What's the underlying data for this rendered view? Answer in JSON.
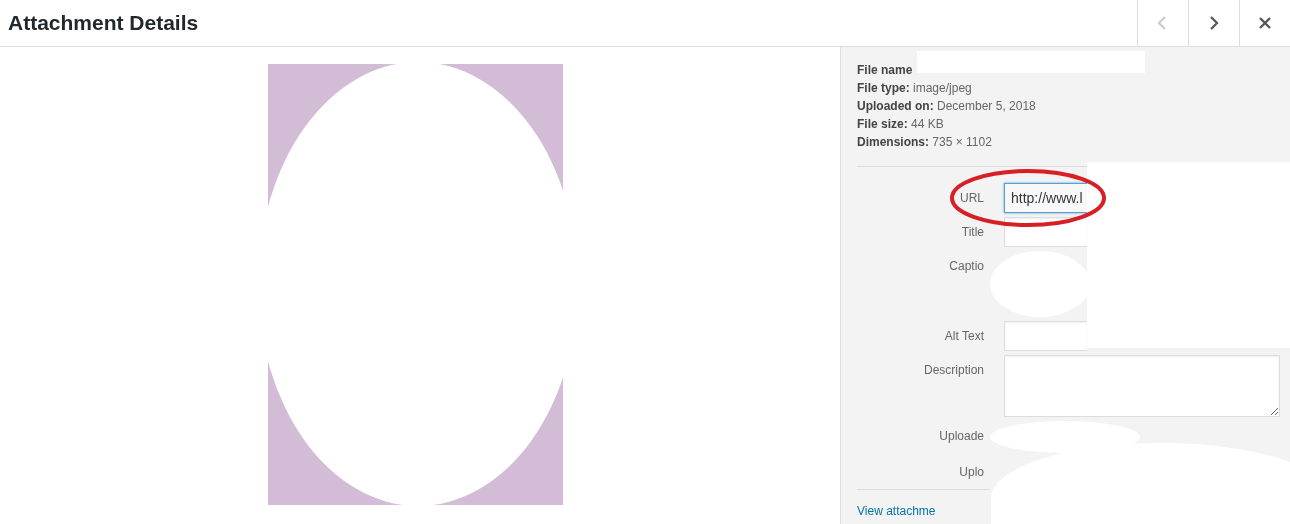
{
  "header": {
    "title": "Attachment Details",
    "buttons": [
      {
        "kind": "prev",
        "disabled": true
      },
      {
        "kind": "next",
        "disabled": false
      },
      {
        "kind": "close",
        "disabled": false
      }
    ]
  },
  "details": [
    {
      "label": "File name"
    },
    {
      "label": "File type:",
      "value": "image/jpeg"
    },
    {
      "label": "Uploaded on:",
      "value": "December 5, 2018"
    },
    {
      "label": "File size:",
      "value": "44 KB"
    },
    {
      "label": "Dimensions:",
      "value": "735 × 1102"
    }
  ],
  "fields": [
    {
      "label": "URL",
      "kind": "input",
      "value": "http://www.l",
      "focused": true
    },
    {
      "label": "Title",
      "kind": "input",
      "focused": false
    },
    {
      "label": "Captio",
      "kind": "hidden"
    },
    {
      "label": "Alt Text",
      "kind": "input",
      "focused": false
    },
    {
      "label": "Description",
      "kind": "textarea",
      "focused": false
    },
    {
      "label": "Uploade",
      "kind": "hidden-line"
    },
    {
      "label": "Uplo",
      "kind": "text"
    }
  ],
  "link": "View attachme"
}
